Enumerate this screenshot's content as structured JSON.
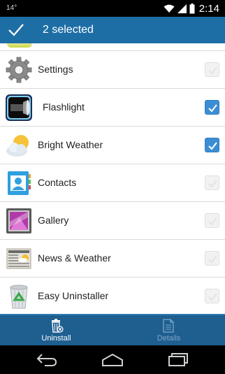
{
  "status_bar": {
    "temperature": "14°",
    "time": "2:14"
  },
  "action_bar": {
    "title": "2 selected"
  },
  "apps": [
    {
      "name": "Settings",
      "checked": false,
      "icon": "settings-gear-icon"
    },
    {
      "name": "Flashlight",
      "checked": true,
      "icon": "flashlight-icon"
    },
    {
      "name": "Bright Weather",
      "checked": true,
      "icon": "weather-sun-cloud-icon"
    },
    {
      "name": "Contacts",
      "checked": false,
      "icon": "contacts-icon"
    },
    {
      "name": "Gallery",
      "checked": false,
      "icon": "gallery-icon"
    },
    {
      "name": "News & Weather",
      "checked": false,
      "icon": "newspaper-icon"
    },
    {
      "name": "Easy Uninstaller",
      "checked": false,
      "icon": "recycle-bin-icon"
    }
  ],
  "bottom_tabs": {
    "uninstall_label": "Uninstall",
    "details_label": "Details"
  },
  "colors": {
    "action_bar": "#1e6ea6",
    "bottom_bar": "#1f5f90",
    "checkbox_checked": "#3c8ed4"
  }
}
